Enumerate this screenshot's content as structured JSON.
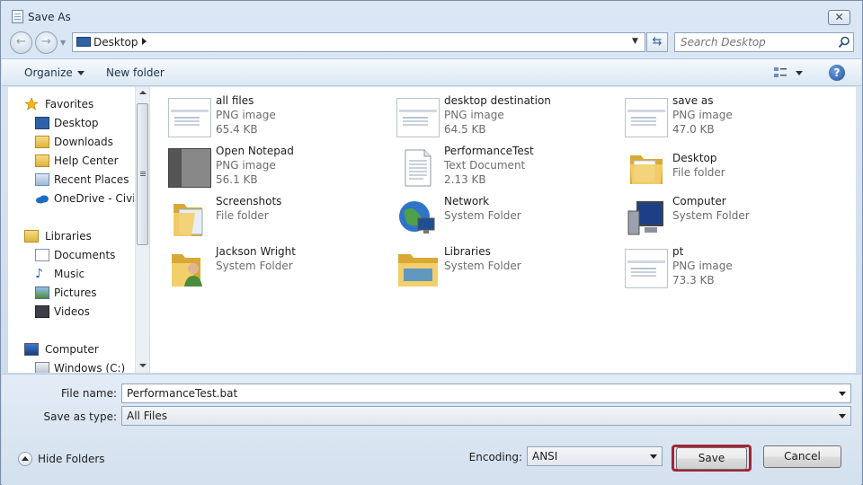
{
  "window": {
    "title": "Save As",
    "close_label": "✕"
  },
  "address": {
    "location": "Desktop"
  },
  "search": {
    "placeholder": "Search Desktop"
  },
  "toolbar": {
    "organize_label": "Organize",
    "new_folder_label": "New folder",
    "help_label": "?"
  },
  "sidebar": {
    "items": [
      {
        "label": "Favorites",
        "icon": "star-icon"
      },
      {
        "label": "Desktop",
        "icon": "desktop-icon"
      },
      {
        "label": "Downloads",
        "icon": "downloads-folder-icon"
      },
      {
        "label": "Help Center",
        "icon": "folder-icon"
      },
      {
        "label": "Recent Places",
        "icon": "recent-places-icon"
      },
      {
        "label": "OneDrive - CivicPlus",
        "icon": "onedrive-icon"
      },
      {
        "label": "Libraries",
        "icon": "libraries-icon"
      },
      {
        "label": "Documents",
        "icon": "documents-icon"
      },
      {
        "label": "Music",
        "icon": "music-icon"
      },
      {
        "label": "Pictures",
        "icon": "pictures-icon"
      },
      {
        "label": "Videos",
        "icon": "videos-icon"
      },
      {
        "label": "Computer",
        "icon": "computer-icon"
      },
      {
        "label": "Windows (C:)",
        "icon": "drive-icon"
      }
    ]
  },
  "files": [
    {
      "name": "all files",
      "type": "PNG image",
      "size": "65.4 KB",
      "icon": "png-thumbnail"
    },
    {
      "name": "desktop destination",
      "type": "PNG image",
      "size": "64.5 KB",
      "icon": "png-thumbnail"
    },
    {
      "name": "save as",
      "type": "PNG image",
      "size": "47.0 KB",
      "icon": "png-thumbnail"
    },
    {
      "name": "Open Notepad",
      "type": "PNG image",
      "size": "56.1 KB",
      "icon": "png-thumbnail-dark"
    },
    {
      "name": "PerformanceTest",
      "type": "Text Document",
      "size": "2.13 KB",
      "icon": "text-document-icon"
    },
    {
      "name": "Desktop",
      "type": "File folder",
      "size": "",
      "icon": "folder-icon"
    },
    {
      "name": "Screenshots",
      "type": "File folder",
      "size": "",
      "icon": "folder-icon"
    },
    {
      "name": "Network",
      "type": "System Folder",
      "size": "",
      "icon": "network-globe-icon"
    },
    {
      "name": "Computer",
      "type": "System Folder",
      "size": "",
      "icon": "computer-icon"
    },
    {
      "name": "Jackson Wright",
      "type": "System Folder",
      "size": "",
      "icon": "user-folder-icon"
    },
    {
      "name": "Libraries",
      "type": "System Folder",
      "size": "",
      "icon": "libraries-icon"
    },
    {
      "name": "pt",
      "type": "PNG image",
      "size": "73.3 KB",
      "icon": "png-thumbnail"
    }
  ],
  "form": {
    "filename_label": "File name:",
    "filename_value": "PerformanceTest.bat",
    "savetype_label": "Save as type:",
    "savetype_value": "All Files",
    "encoding_label": "Encoding:",
    "encoding_value": "ANSI"
  },
  "footer": {
    "hide_folders_label": "Hide Folders",
    "save_label": "Save",
    "cancel_label": "Cancel"
  },
  "colors": {
    "highlight": "#a32535",
    "chrome": "#dbe7f5",
    "link": "#1e3250"
  }
}
